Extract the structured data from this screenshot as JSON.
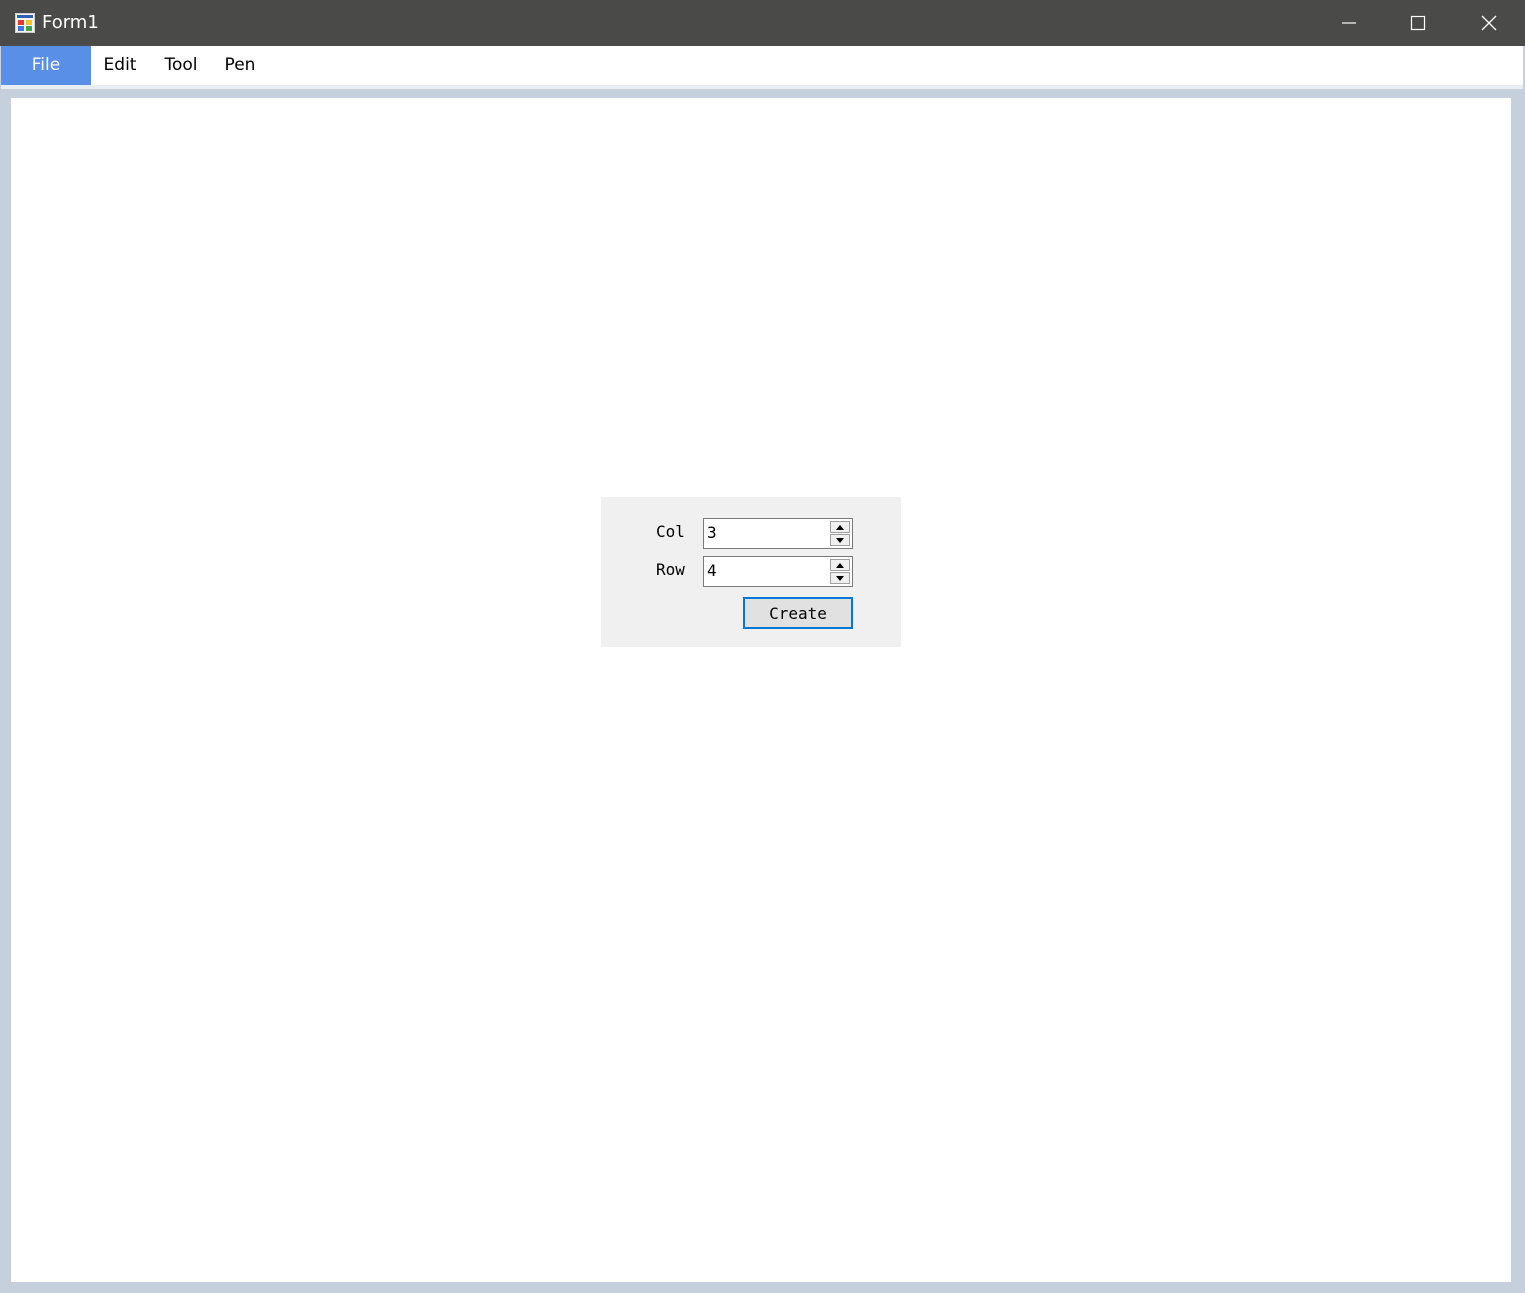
{
  "window": {
    "title": "Form1"
  },
  "menubar": {
    "items": [
      {
        "label": "File"
      },
      {
        "label": "Edit"
      },
      {
        "label": "Tool"
      },
      {
        "label": "Pen"
      }
    ]
  },
  "grid_panel": {
    "col_label": "Col",
    "col_value": "3",
    "row_label": "Row",
    "row_value": "4",
    "create_label": "Create"
  },
  "colors": {
    "titlebar": "#4a4a48",
    "menu_active": "#5a8fe8",
    "button_focus_border": "#0078d7",
    "window_frame": "#c5d0dc"
  }
}
